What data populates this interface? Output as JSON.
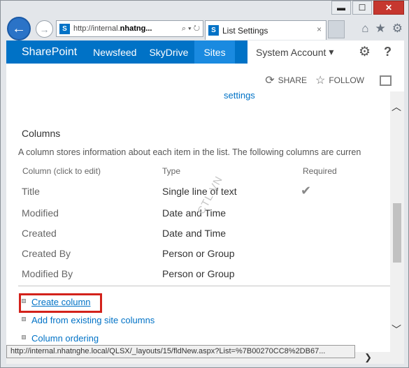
{
  "browser": {
    "address_prefix": "http://internal.",
    "address_bold": "nhatng...",
    "address_icons": "⌕ ▾ ↻",
    "tab_title": "List Settings",
    "tab_close": "×",
    "back_glyph": "←",
    "forward_glyph": "→",
    "caption": {
      "minimize": "▬",
      "maximize": "☐",
      "close": "✕"
    },
    "right_icons": {
      "home": "⌂",
      "favorites": "★",
      "tools": "⚙"
    }
  },
  "suite": {
    "brand": "SharePoint",
    "links": [
      "Newsfeed",
      "SkyDrive",
      "Sites"
    ],
    "active_link": "Sites",
    "account": "System Account",
    "account_caret": "▾",
    "help": "?"
  },
  "actions": {
    "share": "SHARE",
    "follow": "FOLLOW"
  },
  "content": {
    "top_link": "settings",
    "section_title": "Columns",
    "description": "A column stores information about each item in the list. The following columns are curren",
    "headers": {
      "name": "Column (click to edit)",
      "type": "Type",
      "required": "Required"
    },
    "rows": [
      {
        "name": "Title",
        "type": "Single line of text",
        "required": true
      },
      {
        "name": "Modified",
        "type": "Date and Time",
        "required": false
      },
      {
        "name": "Created",
        "type": "Date and Time",
        "required": false
      },
      {
        "name": "Created By",
        "type": "Person or Group",
        "required": false
      },
      {
        "name": "Modified By",
        "type": "Person or Group",
        "required": false
      }
    ],
    "check_glyph": "✔",
    "links": {
      "create_column": "Create column",
      "add_existing": "Add from existing site columns",
      "column_ordering": "Column ordering"
    },
    "watermark": "CTL.VN"
  },
  "statusbar": {
    "url": "http://internal.nhatnghe.local/QLSX/_layouts/15/fldNew.aspx?List=%7B00270CC8%2DB67..."
  },
  "scrollbar": {
    "up": "︿",
    "down": "﹀",
    "right": "❯"
  },
  "colors": {
    "suite_bar": "#0072c6",
    "active_tab": "#1a8ae0",
    "link": "#0072c6",
    "highlight_box": "#d3221b"
  }
}
